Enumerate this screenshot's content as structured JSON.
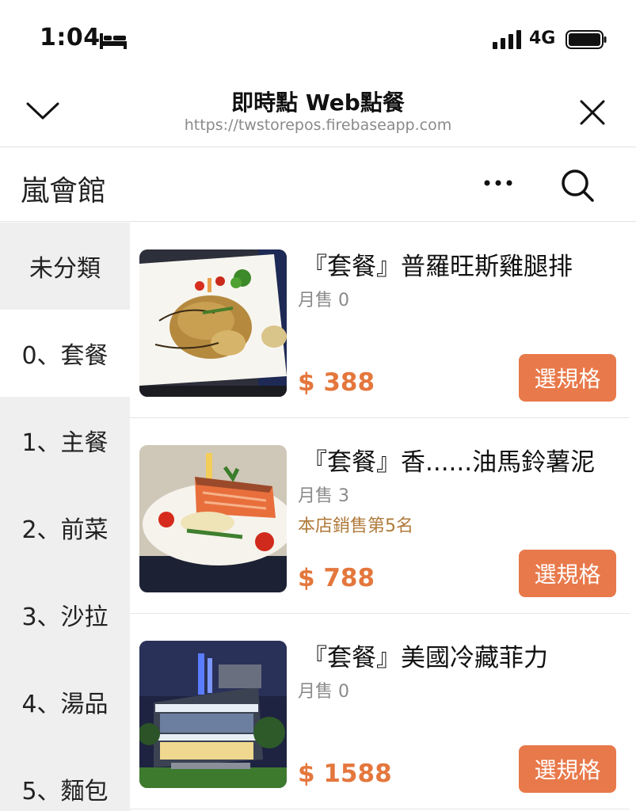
{
  "status_bar": {
    "time": "1:04",
    "network": "4G",
    "sleep_icon": "bed-icon",
    "signal_icon": "signal-icon",
    "battery_icon": "battery-icon"
  },
  "browser": {
    "title": "即時點 Web點餐",
    "url": "https://twstorepos.firebaseapp.com",
    "collapse_icon": "chevron-down-icon",
    "close_icon": "close-icon"
  },
  "store": {
    "name": "嵐會館",
    "more_icon": "more-icon",
    "search_icon": "search-icon"
  },
  "categories": [
    {
      "label": "未分類"
    },
    {
      "label": "0、套餐",
      "active": true
    },
    {
      "label": "1、主餐"
    },
    {
      "label": "2、前菜"
    },
    {
      "label": "3、沙拉"
    },
    {
      "label": "4、湯品"
    },
    {
      "label": "5、麵包"
    }
  ],
  "products": [
    {
      "name": "『套餐』普羅旺斯雞腿排",
      "sold": "月售 0",
      "rank": "",
      "price": "$ 388",
      "button": "選規格",
      "image": "chicken-dish-photo"
    },
    {
      "name": "『套餐』香......油馬鈴薯泥",
      "sold": "月售 3",
      "rank": "本店銷售第5名",
      "price": "$ 788",
      "button": "選規格",
      "image": "salmon-dish-photo"
    },
    {
      "name": "『套餐』美國冷藏菲力",
      "sold": "月售 0",
      "rank": "",
      "price": "$ 1588",
      "button": "選規格",
      "image": "restaurant-building-photo"
    }
  ]
}
